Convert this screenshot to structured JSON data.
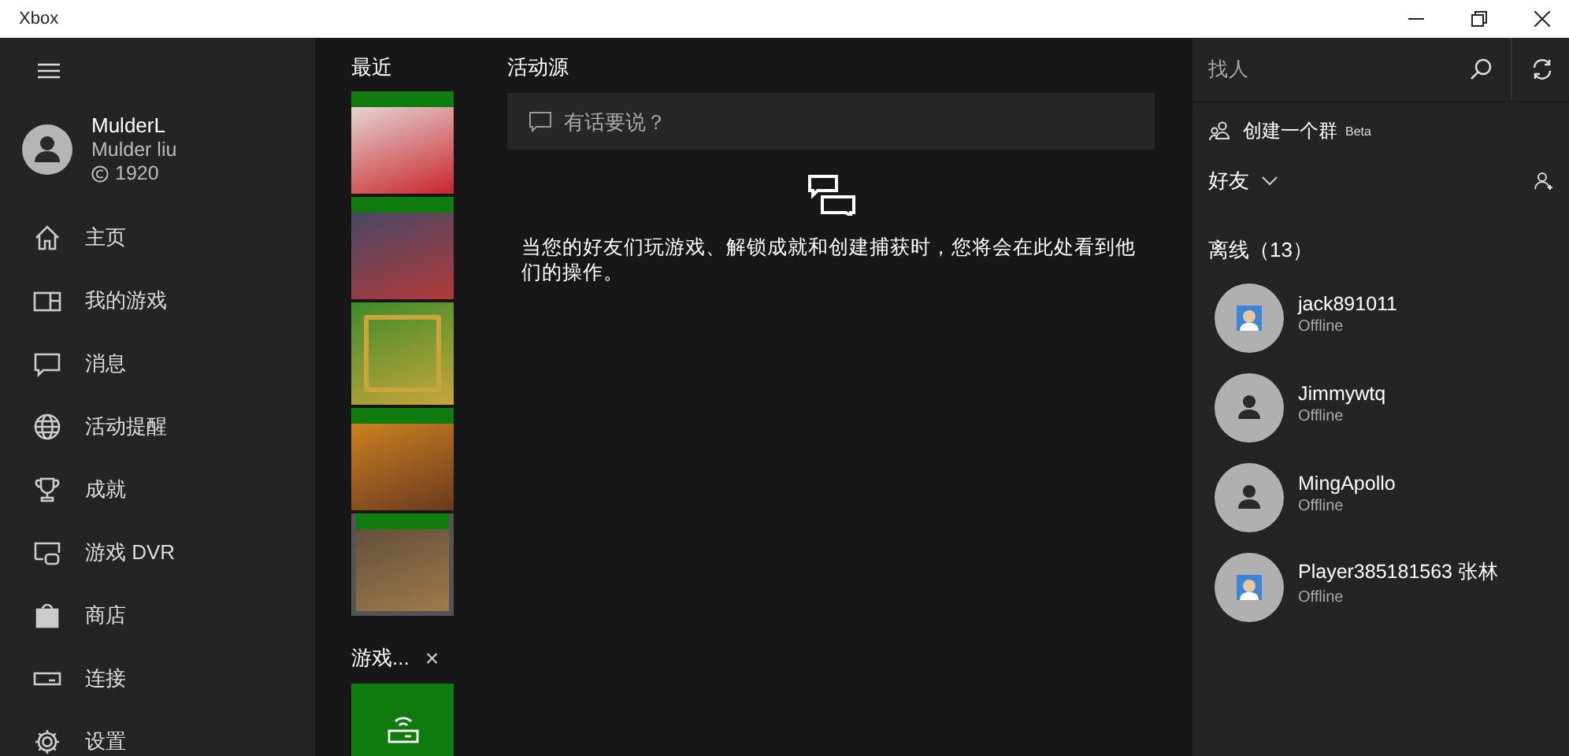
{
  "window": {
    "title": "Xbox"
  },
  "sidebar": {
    "profile": {
      "gamertag": "MulderL",
      "name": "Mulder liu",
      "gamerscore": "1920"
    },
    "items": [
      {
        "label": "主页",
        "kind": "home"
      },
      {
        "label": "我的游戏",
        "kind": "games"
      },
      {
        "label": "消息",
        "kind": "messages"
      },
      {
        "label": "活动提醒",
        "kind": "globe"
      },
      {
        "label": "成就",
        "kind": "trophy"
      },
      {
        "label": "游戏 DVR",
        "kind": "dvr"
      },
      {
        "label": "商店",
        "kind": "store"
      },
      {
        "label": "连接",
        "kind": "connect"
      },
      {
        "label": "设置",
        "kind": "settings"
      }
    ]
  },
  "recent": {
    "title": "最近",
    "tiles": [
      {
        "kind": "racing"
      },
      {
        "kind": "football"
      },
      {
        "kind": "emblem"
      },
      {
        "kind": "action"
      },
      {
        "kind": "soldier"
      }
    ]
  },
  "pins": {
    "title": "游戏...",
    "close": "×"
  },
  "feed": {
    "title": "活动源",
    "composer": {
      "placeholder": "有话要说？"
    },
    "empty_message": "当您的好友们玩游戏、解锁成就和创建捕获时，您将会在此处看到他们的操作。"
  },
  "friends": {
    "search": {
      "placeholder": "找人"
    },
    "create_group": {
      "label": "创建一个群",
      "badge": "Beta"
    },
    "filter": "好友",
    "section": "离线（13）",
    "list": [
      {
        "name": "jack891011",
        "status": "Offline",
        "kind": "picture"
      },
      {
        "name": "Jimmywtq",
        "status": "Offline",
        "kind": "silhouette"
      },
      {
        "name": "MingApollo",
        "status": "Offline",
        "kind": "silhouette"
      },
      {
        "name": "Player385181563 张林",
        "status": "Offline",
        "kind": "picture"
      }
    ]
  }
}
